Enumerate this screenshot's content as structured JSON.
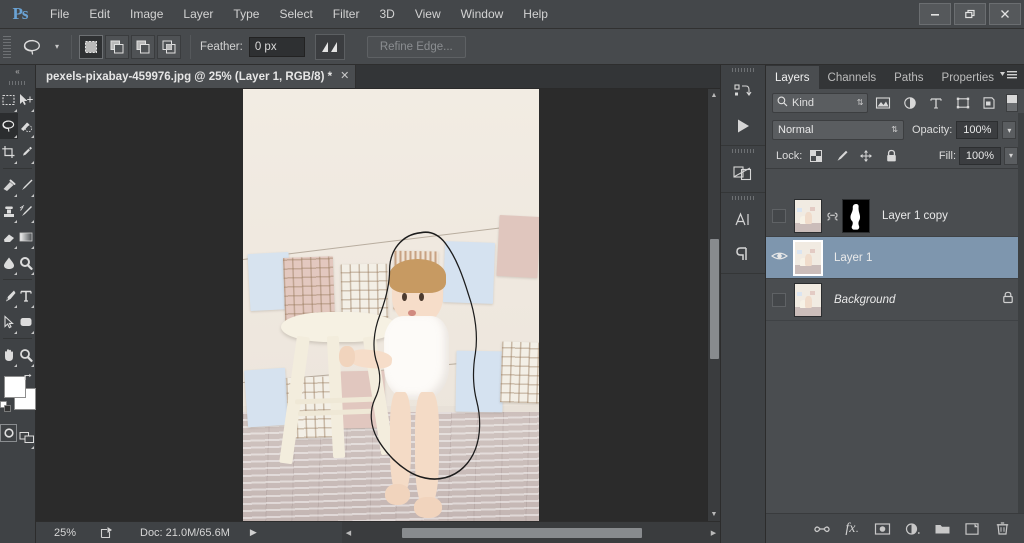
{
  "app": {
    "logo": "Ps"
  },
  "menubar": {
    "items": [
      {
        "label": "File"
      },
      {
        "label": "Edit"
      },
      {
        "label": "Image"
      },
      {
        "label": "Layer"
      },
      {
        "label": "Type"
      },
      {
        "label": "Select"
      },
      {
        "label": "Filter"
      },
      {
        "label": "3D"
      },
      {
        "label": "View"
      },
      {
        "label": "Window"
      },
      {
        "label": "Help"
      }
    ],
    "window_controls": [
      {
        "name": "minimize-button",
        "glyph": "—"
      },
      {
        "name": "restore-button",
        "glyph": "❐"
      },
      {
        "name": "close-button",
        "glyph": "✕"
      }
    ]
  },
  "options_bar": {
    "active_tool": "lasso-tool",
    "tool_preset_caret": "▾",
    "selection_modes": [
      {
        "name": "new-selection",
        "active": true
      },
      {
        "name": "add-to-selection",
        "active": false
      },
      {
        "name": "subtract-from-selection",
        "active": false
      },
      {
        "name": "intersect-with-selection",
        "active": false
      }
    ],
    "feather_label": "Feather:",
    "feather_value": "0 px",
    "antialias_icon": "anti-alias-icon",
    "refine_edge_label": "Refine Edge...",
    "refine_edge_enabled": false
  },
  "toolbar": {
    "collapse_glyph": "«",
    "tools": [
      {
        "name": "rectangular-marquee-tool",
        "active": false
      },
      {
        "name": "move-tool",
        "active": false
      },
      {
        "name": "lasso-tool",
        "active": true
      },
      {
        "name": "quick-selection-tool",
        "active": false
      },
      {
        "name": "crop-tool",
        "active": false
      },
      {
        "name": "eyedropper-tool",
        "active": false
      },
      {
        "name": "spot-healing-brush-tool",
        "active": false
      },
      {
        "name": "brush-tool",
        "active": false
      },
      {
        "name": "clone-stamp-tool",
        "active": false
      },
      {
        "name": "history-brush-tool",
        "active": false
      },
      {
        "name": "eraser-tool",
        "active": false
      },
      {
        "name": "gradient-tool",
        "active": false
      },
      {
        "name": "blur-tool",
        "active": false
      },
      {
        "name": "dodge-tool",
        "active": false
      },
      {
        "name": "pen-tool",
        "active": false
      },
      {
        "name": "horizontal-type-tool",
        "active": false
      },
      {
        "name": "path-selection-tool",
        "active": false
      },
      {
        "name": "rectangle-tool",
        "active": false
      },
      {
        "name": "hand-tool",
        "active": false
      },
      {
        "name": "zoom-tool",
        "active": false
      }
    ],
    "foreground_color": "#ffffff",
    "background_color": "#ffffff",
    "quick_mask_name": "quick-mask-mode-button",
    "screen_mode_name": "screen-mode-button"
  },
  "document": {
    "tab_title": "pexels-pixabay-459976.jpg @ 25% (Layer 1, RGB/8) *",
    "close_glyph": "✕"
  },
  "status_bar": {
    "zoom": "25%",
    "share_icon": "share-icon",
    "doc_info": "Doc: 21.0M/65.6M",
    "arrow_glyph": "▶"
  },
  "icon_dock": {
    "groups": [
      {
        "icons": [
          {
            "name": "history-panel-icon"
          },
          {
            "name": "actions-panel-icon",
            "glyph": "▶"
          }
        ]
      },
      {
        "icons": [
          {
            "name": "adjustments-panel-icon"
          }
        ]
      },
      {
        "icons": [
          {
            "name": "character-panel-icon",
            "glyph": "A"
          },
          {
            "name": "paragraph-panel-icon",
            "glyph": "¶"
          }
        ]
      }
    ]
  },
  "layers_panel": {
    "tabs": [
      {
        "label": "Layers",
        "active": true
      },
      {
        "label": "Channels",
        "active": false
      },
      {
        "label": "Paths",
        "active": false
      },
      {
        "label": "Properties",
        "active": false
      }
    ],
    "menu_icon": "panel-menu-icon",
    "filter": {
      "kind_label": "Kind",
      "search_icon": "search-icon",
      "caret": "⇅",
      "icons": [
        {
          "name": "filter-pixel-layers-icon"
        },
        {
          "name": "filter-adjustment-layers-icon"
        },
        {
          "name": "filter-type-layers-icon"
        },
        {
          "name": "filter-shape-layers-icon"
        },
        {
          "name": "filter-smart-object-layers-icon"
        }
      ],
      "toggle_name": "filter-enable-toggle"
    },
    "blend_mode": "Normal",
    "blend_caret": "⇅",
    "opacity_label": "Opacity:",
    "opacity_value": "100%",
    "lock_label": "Lock:",
    "lock_icons": [
      {
        "name": "lock-transparent-pixels-icon"
      },
      {
        "name": "lock-image-pixels-icon"
      },
      {
        "name": "lock-position-icon"
      },
      {
        "name": "lock-all-icon"
      }
    ],
    "fill_label": "Fill:",
    "fill_value": "100%",
    "layers": [
      {
        "name": "Layer 1 copy",
        "visible": false,
        "selected": false,
        "has_mask": true,
        "linked": true,
        "locked": false,
        "italic": false
      },
      {
        "name": "Layer 1",
        "visible": true,
        "selected": true,
        "has_mask": false,
        "linked": false,
        "locked": false,
        "italic": false
      },
      {
        "name": "Background",
        "visible": false,
        "selected": false,
        "has_mask": false,
        "linked": false,
        "locked": true,
        "italic": true
      }
    ],
    "footer_icons": [
      {
        "name": "link-layers-icon",
        "glyph": "∞"
      },
      {
        "name": "layer-style-fx-icon",
        "glyph": "fx"
      },
      {
        "name": "add-layer-mask-icon"
      },
      {
        "name": "new-adjustment-layer-icon"
      },
      {
        "name": "new-group-icon"
      },
      {
        "name": "new-layer-icon"
      },
      {
        "name": "delete-layer-icon"
      }
    ]
  },
  "canvas": {
    "zoom_level": "25%",
    "selection_active": true,
    "selection_tool": "lasso",
    "scrollbar_up": "▲",
    "scrollbar_down": "▼",
    "scrollbar_left": "◀",
    "scrollbar_right": "▶"
  }
}
